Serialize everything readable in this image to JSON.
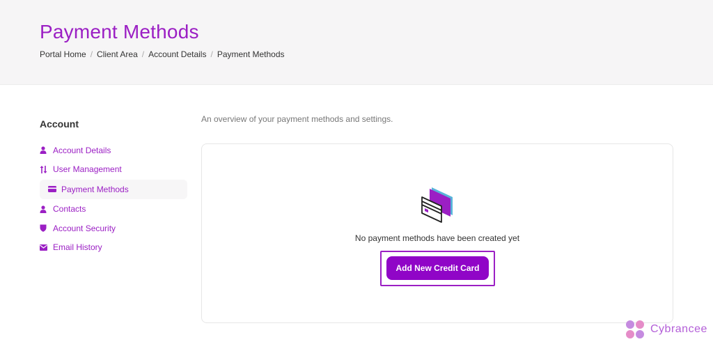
{
  "header": {
    "title": "Payment Methods",
    "breadcrumb": [
      "Portal Home",
      "Client Area",
      "Account Details",
      "Payment Methods"
    ]
  },
  "sidebar": {
    "heading": "Account",
    "items": [
      {
        "label": "Account Details",
        "icon": "user-icon"
      },
      {
        "label": "User Management",
        "icon": "arrows-updown-icon"
      },
      {
        "label": "Payment Methods",
        "icon": "credit-card-icon",
        "active": true
      },
      {
        "label": "Contacts",
        "icon": "user-icon"
      },
      {
        "label": "Account Security",
        "icon": "shield-icon"
      },
      {
        "label": "Email History",
        "icon": "envelope-icon"
      }
    ]
  },
  "main": {
    "overview": "An overview of your payment methods and settings.",
    "empty_text": "No payment methods have been created yet",
    "add_button": "Add New Credit Card"
  },
  "brand": {
    "name": "Cybrancee"
  },
  "colors": {
    "accent": "#9b1fc4",
    "button": "#9005c7"
  }
}
